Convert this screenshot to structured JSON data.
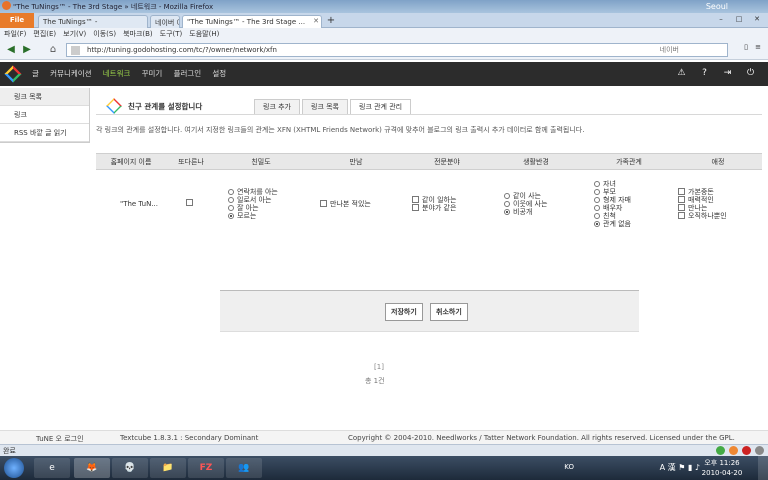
{
  "browser": {
    "window_title": "\"The TuNings™ - The 3rd Stage » 네트워크 - Mozilla Firefox",
    "weather_city": "Seoul",
    "file_button": "File",
    "tabs": [
      {
        "label": "The TuNings™ -"
      },
      {
        "label": "네이버 이미지 ..."
      },
      {
        "label": "\"The TuNings™ - The 3rd Stage ..."
      }
    ],
    "new_tab": "+",
    "win_controls": [
      "–",
      "□",
      "✕"
    ],
    "menu": [
      "파일(F)",
      "편집(E)",
      "보기(V)",
      "이동(S)",
      "북마크(B)",
      "도구(T)",
      "도움말(H)"
    ],
    "url": "http://tuning.godohosting.com/tc/?/owner/network/xfn",
    "search_engine": "네이버"
  },
  "app": {
    "menu": [
      {
        "label": "글",
        "active": false
      },
      {
        "label": "커뮤니케이션",
        "active": false
      },
      {
        "label": "네트워크",
        "active": true
      },
      {
        "label": "꾸미기",
        "active": false
      },
      {
        "label": "플러그인",
        "active": false
      },
      {
        "label": "설정",
        "active": false
      }
    ],
    "icons": [
      "warning-icon",
      "help-icon",
      "logout-icon",
      "power-icon"
    ]
  },
  "sidebar": {
    "items": [
      {
        "label": "링크 목록"
      },
      {
        "label": "링크"
      },
      {
        "label": "RSS 바깥 글 읽기"
      }
    ]
  },
  "page": {
    "title": "친구 관계를 설정합니다",
    "tabs": [
      {
        "label": "링크 추가",
        "active": false
      },
      {
        "label": "링크 목록",
        "active": false
      },
      {
        "label": "링크 관계 관리",
        "active": true
      }
    ],
    "description": "각 링크의 관계를 설정합니다. 여기서 지정한 링크들의 관계는 XFN (XHTML Friends Network) 규격에 맞추어 블로그의 링크 출력시 추가 데이터로 함께 출력됩니다."
  },
  "table": {
    "headers": [
      "홈페이지 이름",
      "또다른나",
      "친밀도",
      "만남",
      "전문분야",
      "생활반경",
      "가족관계",
      "애정"
    ],
    "row": {
      "homepage": "\"The TuN...",
      "me_checked": false,
      "intimacy": {
        "options": [
          "연락처를 아는",
          "일로서 아는",
          "잘 아는",
          "모르는"
        ],
        "selected": 3
      },
      "meeting": {
        "options": [
          "만나본 적있는"
        ]
      },
      "professional": {
        "options": [
          "같이 일하는",
          "분야가 같은"
        ]
      },
      "geographical": {
        "options": [
          "같이 사는",
          "이웃에 사는",
          "비공개"
        ],
        "selected": 2
      },
      "family": {
        "options": [
          "자녀",
          "부모",
          "형제 자매",
          "배우자",
          "친척",
          "관계 없음"
        ],
        "selected": 5
      },
      "romantic": {
        "options": [
          "가본중돈",
          "매력적인",
          "만나는",
          "오직하나뿐인"
        ]
      }
    }
  },
  "buttons": {
    "save": "저장하기",
    "cancel": "취소하기"
  },
  "pagination": {
    "page": "[1]",
    "total": "총 1건"
  },
  "footer": {
    "left": "TuNE 오 로그인",
    "middle": "Textcube 1.8.3.1 : Secondary Dominant",
    "right": "Copyright © 2004-2010. Needlworks / Tatter Network Foundation. All rights reserved. Licensed under the GPL."
  },
  "status": {
    "text": "완료"
  },
  "taskbar": {
    "apps": [
      "e",
      "🦊",
      "💀",
      "📁",
      "FZ",
      "👥"
    ],
    "ime": "KO",
    "time": "오후 11:26",
    "date": "2010-04-20"
  }
}
